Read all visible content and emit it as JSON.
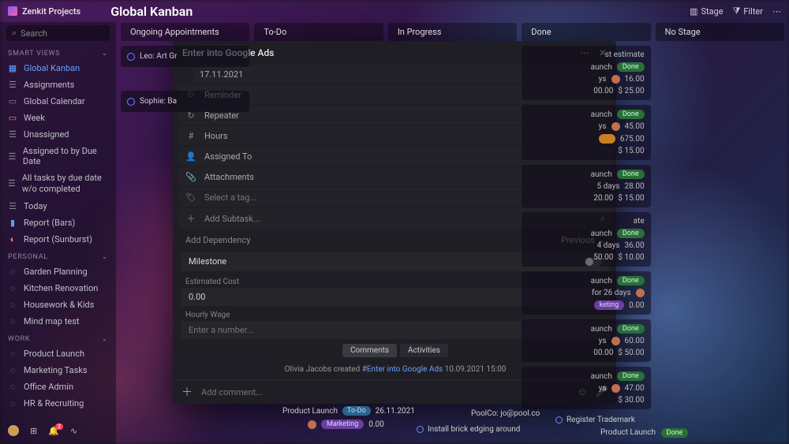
{
  "app_name": "Zenkit Projects",
  "page_title": "Global Kanban",
  "search_placeholder": "Search",
  "top_right": {
    "stage": "Stage",
    "filter": "Filter"
  },
  "sections": {
    "smart_views": {
      "label": "SMART VIEWS"
    },
    "personal": {
      "label": "PERSONAL"
    },
    "work": {
      "label": "WORK"
    }
  },
  "nav": {
    "global_kanban": "Global Kanban",
    "assignments": "Assignments",
    "global_calendar": "Global Calendar",
    "week": "Week",
    "unassigned": "Unassigned",
    "assigned_due": "Assigned to by Due Date",
    "all_tasks": "All tasks by due date w/o completed",
    "today": "Today",
    "report_bars": "Report (Bars)",
    "report_sun": "Report (Sunburst)",
    "garden": "Garden Planning",
    "kitchen": "Kitchen Renovation",
    "housework": "Housework & Kids",
    "mindmap": "Mind map test",
    "product_launch": "Product Launch",
    "marketing_tasks": "Marketing Tasks",
    "office_admin": "Office Admin",
    "hr": "HR & Recruiting"
  },
  "bell_count": "2",
  "columns": {
    "c1": "Ongoing Appointments",
    "c2": "To-Do",
    "c3": "In Progress",
    "c4": "Done",
    "c5": "No Stage"
  },
  "cards": {
    "leo": "Leo: Art Gr",
    "sophie": "Sophie: Ba"
  },
  "done_frag": {
    "title_frag": "st estimate",
    "launch": "aunch",
    "done": "Done",
    "five_days": "5 days",
    "four_days": "4 days",
    "due26": "for 26 days",
    "ys": "ys",
    "ate": "ate",
    "keting": "keting",
    "v1_16": "16.00",
    "v2_0000": "00.00",
    "v2_25": "$ 25.00",
    "v3_45": "45.00",
    "v4_675": "675.00",
    "v5_15": "$ 15.00",
    "v6_28": "28.00",
    "v7_20": "20.00",
    "v7_15": "$ 15.00",
    "v8_36": "36.00",
    "v9_50": "50.00",
    "v9_10": "$ 10.00",
    "v10_0": "0.00",
    "v11_60": "60.00",
    "v12_50b": "$ 50.00",
    "v13_47": "47.00",
    "v14_30": "$ 30.00",
    "v12_00b": "00.00"
  },
  "modal": {
    "title": "Enter into Google Ads",
    "date": "17.11.2021",
    "reminder": "Reminder",
    "repeater": "Repeater",
    "hours": "Hours",
    "assigned_to": "Assigned To",
    "attachments": "Attachments",
    "select_tag": "Select a tag...",
    "add_subtask": "Add Subtask...",
    "add_dep": "Add Dependency",
    "previous": "Previous",
    "milestone": "Milestone",
    "est_cost_label": "Estimated Cost",
    "est_cost_value": "0.00",
    "hourly_label": "Hourly Wage",
    "hourly_placeholder": "Enter a number...",
    "tab_comments": "Comments",
    "tab_activities": "Activities",
    "activity_author": "Olivia Jacobs created ",
    "activity_link": "#Enter into Google Ads",
    "activity_ts": " 10.09.2021 15:00",
    "comment_placeholder": "Add comment..."
  },
  "below": {
    "product_launch": "Product Launch",
    "todo": "To-Do",
    "date": "26.11.2021",
    "marketing": "Marketing",
    "zero": "0.00",
    "poolco": "PoolCo: jo@pool.co",
    "brick": "Install brick edging around",
    "register_tm": "Register Trademark",
    "product_launch2": "Product Launch",
    "done": "Done"
  }
}
